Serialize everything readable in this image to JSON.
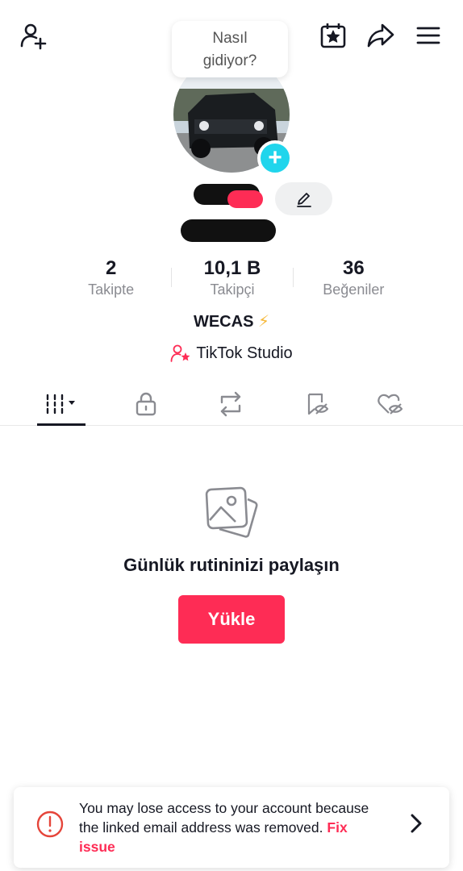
{
  "header": {
    "icons": [
      "add-friend-icon",
      "calendar-star-icon",
      "share-icon",
      "menu-icon"
    ]
  },
  "status_bubble": {
    "line1": "Nasıl",
    "line2": "gidiyor?"
  },
  "profile": {
    "add_avatar_symbol": "+"
  },
  "stats": [
    {
      "value": "2",
      "label": "Takipte"
    },
    {
      "value": "10,1 B",
      "label": "Takipçi"
    },
    {
      "value": "36",
      "label": "Beğeniler"
    }
  ],
  "bio": {
    "text": "WECAS",
    "emoji": "⚡"
  },
  "studio_link": {
    "label": "TikTok Studio"
  },
  "tabs": [
    "videos-grid-tab",
    "private-tab",
    "reposts-tab",
    "favorites-tab",
    "liked-tab"
  ],
  "empty_state": {
    "title": "Günlük rutininizi paylaşın",
    "button": "Yükle"
  },
  "warning": {
    "message": "You may lose access to your account because the linked email address was removed.",
    "action": "Fix issue"
  },
  "colors": {
    "accent": "#fe2c55",
    "avatar_add": "#20d5ec",
    "text_primary": "#161823",
    "text_secondary": "#8a8b91"
  }
}
